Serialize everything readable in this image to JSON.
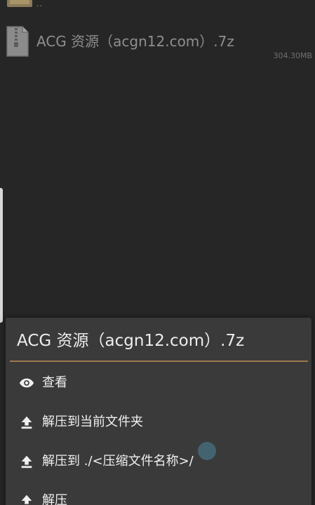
{
  "parent": {
    "label": "..",
    "icon": "folder-icon"
  },
  "file": {
    "name": "ACG 资源（acgn12.com）.7z",
    "size": "304.30MB",
    "icon": "archive-file-icon"
  },
  "menu": {
    "title": "ACG 资源（acgn12.com）.7z",
    "accent_color": "#9c7a4e",
    "items": [
      {
        "label": "查看",
        "icon": "eye-icon"
      },
      {
        "label": "解压到当前文件夹",
        "icon": "upload-icon"
      },
      {
        "label": "解压到 ./<压缩文件名称>/",
        "icon": "upload-icon"
      },
      {
        "label": "解压",
        "icon": "upload-icon"
      }
    ]
  }
}
